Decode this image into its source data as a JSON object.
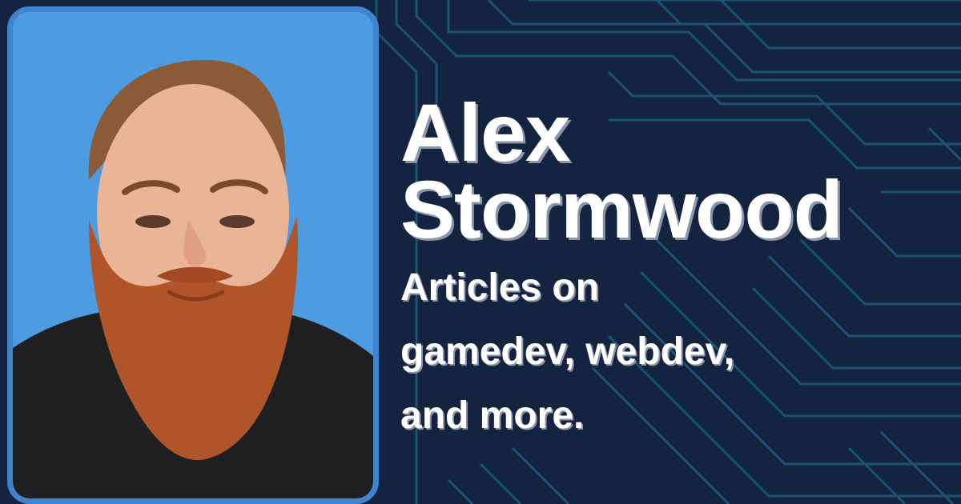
{
  "profile": {
    "first_name": "Alex",
    "last_name": "Stormwood",
    "tagline_lines": [
      "Articles on",
      "gamedev, webdev,",
      "and more."
    ]
  },
  "photo": {
    "subject": "portrait-photo"
  },
  "colors": {
    "background": "#14233f",
    "circuit_lines": "#1e5a78",
    "photo_border": "#3f84cf",
    "photo_background": "#4d9be0",
    "text": "#ffffff"
  }
}
